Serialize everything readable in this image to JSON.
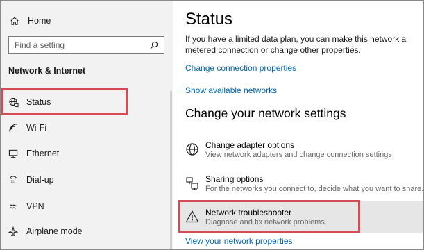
{
  "sidebar": {
    "home_label": "Home",
    "search_placeholder": "Find a setting",
    "section_title": "Network & Internet",
    "items": [
      {
        "label": "Status",
        "icon": "globe-network-icon"
      },
      {
        "label": "Wi-Fi",
        "icon": "wifi-icon"
      },
      {
        "label": "Ethernet",
        "icon": "ethernet-icon"
      },
      {
        "label": "Dial-up",
        "icon": "dialup-icon"
      },
      {
        "label": "VPN",
        "icon": "vpn-icon"
      },
      {
        "label": "Airplane mode",
        "icon": "airplane-icon"
      }
    ]
  },
  "main": {
    "title": "Status",
    "description": "If you have a limited data plan, you can make this network a metered connection or change other properties.",
    "link_change_connection": "Change connection properties",
    "link_show_networks": "Show available networks",
    "subheading": "Change your network settings",
    "options": [
      {
        "title": "Change adapter options",
        "subtitle": "View network adapters and change connection settings.",
        "icon": "globe-icon"
      },
      {
        "title": "Sharing options",
        "subtitle": "For the networks you connect to, decide what you want to share.",
        "icon": "sharing-icon"
      },
      {
        "title": "Network troubleshooter",
        "subtitle": "Diagnose and fix network problems.",
        "icon": "warning-icon"
      }
    ],
    "link_view_properties": "View your network properties"
  },
  "colors": {
    "link": "#0067b8",
    "highlight": "#d44a55",
    "sidebar_bg": "#f2f2f2"
  }
}
